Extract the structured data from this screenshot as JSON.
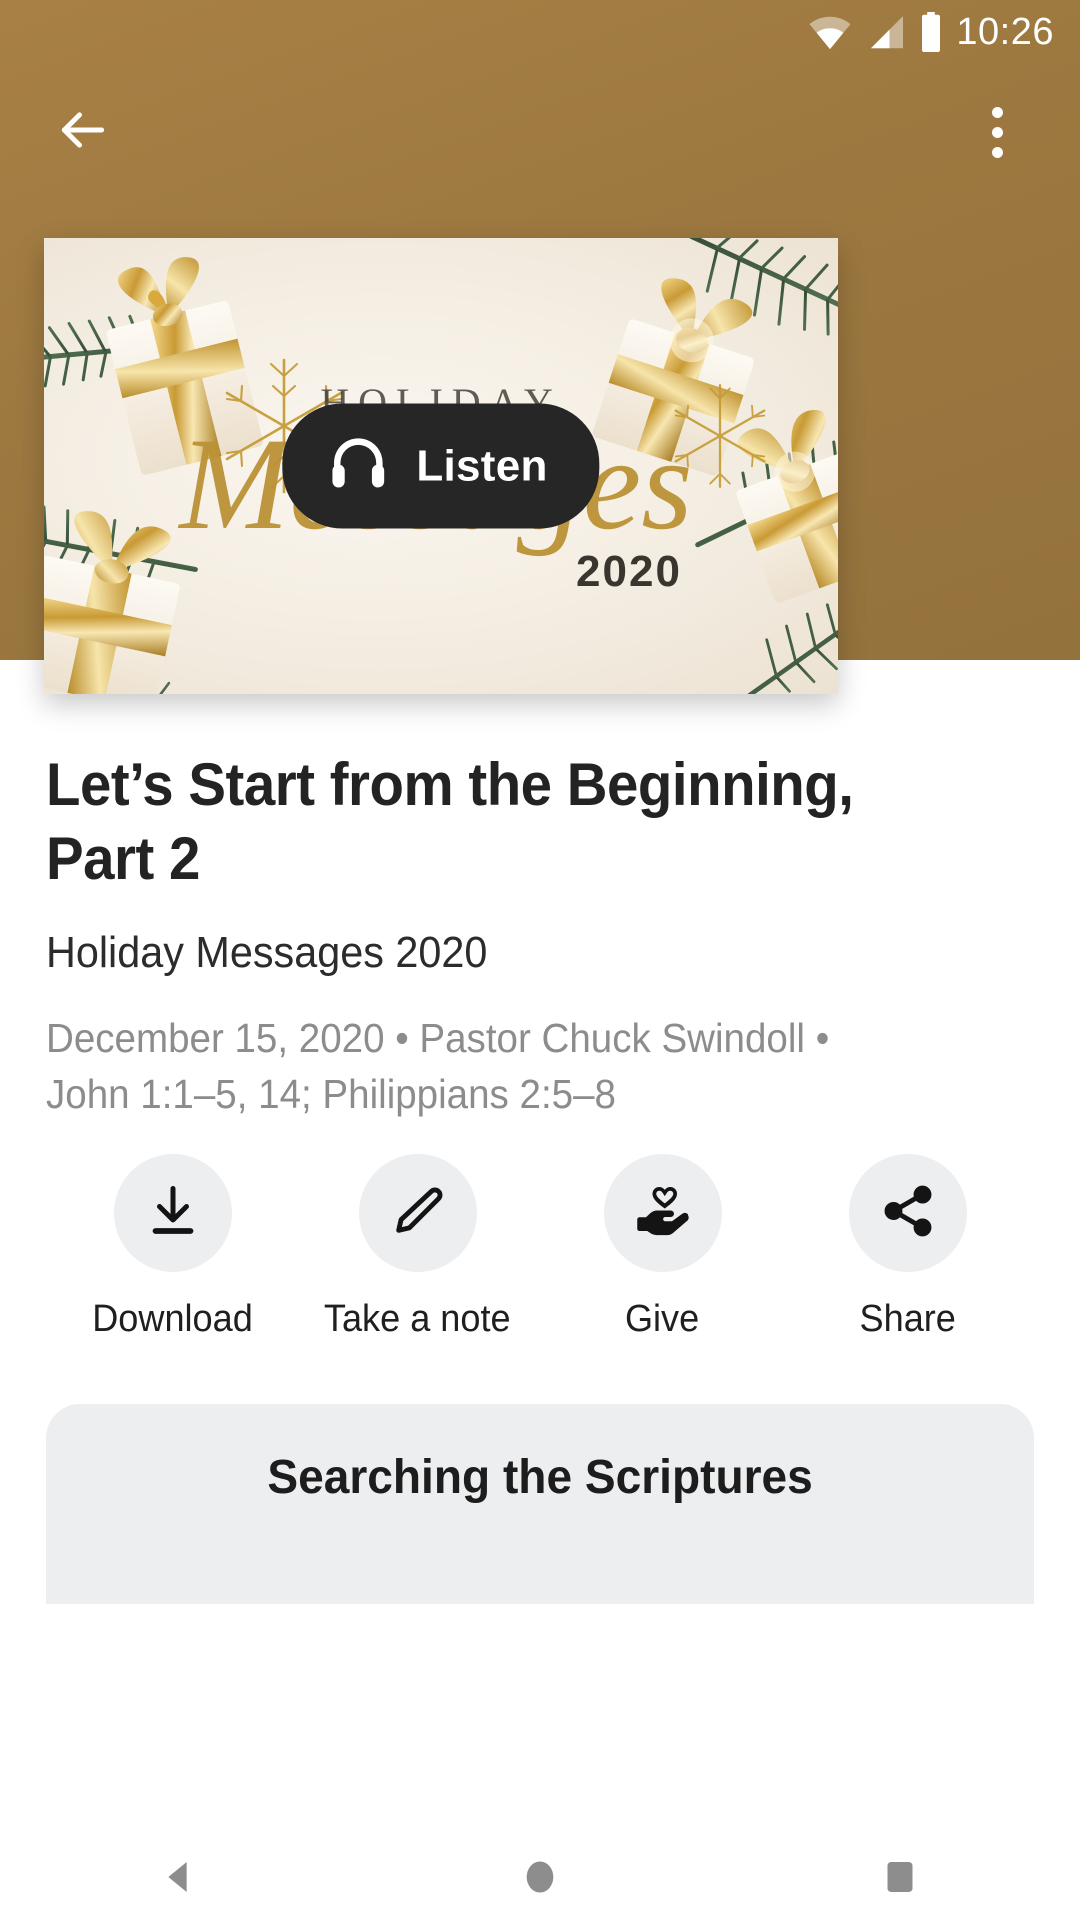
{
  "status_bar": {
    "time": "10:26",
    "icons": [
      "wifi-icon",
      "cellular-signal-icon",
      "battery-icon"
    ]
  },
  "app_bar": {
    "back_label": "back-arrow-icon",
    "overflow_label": "more-options-icon",
    "background_color": "#9d7940"
  },
  "hero": {
    "artwork_alt": "Holiday Messages 2020 artwork with gold gift boxes, pine branches and gold snowflakes",
    "artwork_text_top": "HOLIDAY",
    "artwork_text_script": "Messages",
    "artwork_text_year": "2020",
    "listen_button": {
      "label": "Listen",
      "icon": "headphones-icon",
      "background_color": "#262626",
      "text_color": "#ffffff"
    }
  },
  "sermon": {
    "title": "Let’s Start from the Beginning, Part 2",
    "series": "Holiday Messages 2020",
    "meta_line_1": "December 15, 2020 • Pastor Chuck Swindoll •",
    "meta_line_2": "John 1:1–5, 14; Philippians 2:5–8",
    "date": "December 15, 2020",
    "speaker": "Pastor Chuck Swindoll",
    "scripture": "John 1:1–5, 14; Philippians 2:5–8"
  },
  "actions": [
    {
      "label": "Download",
      "icon": "download-icon"
    },
    {
      "label": "Take a note",
      "icon": "pencil-icon"
    },
    {
      "label": "Give",
      "icon": "hand-heart-icon"
    },
    {
      "label": "Share",
      "icon": "share-icon"
    }
  ],
  "scripture_card": {
    "title": "Searching the Scriptures",
    "background_color": "#eceef0"
  },
  "nav_bar": {
    "back": "nav-back-triangle-icon",
    "home": "nav-home-circle-icon",
    "recents": "nav-recents-square-icon"
  },
  "colors": {
    "header_brown": "#9d7940",
    "chip_gray": "#eceef0",
    "muted_text": "#8c8c8c",
    "primary_text": "#232323"
  }
}
